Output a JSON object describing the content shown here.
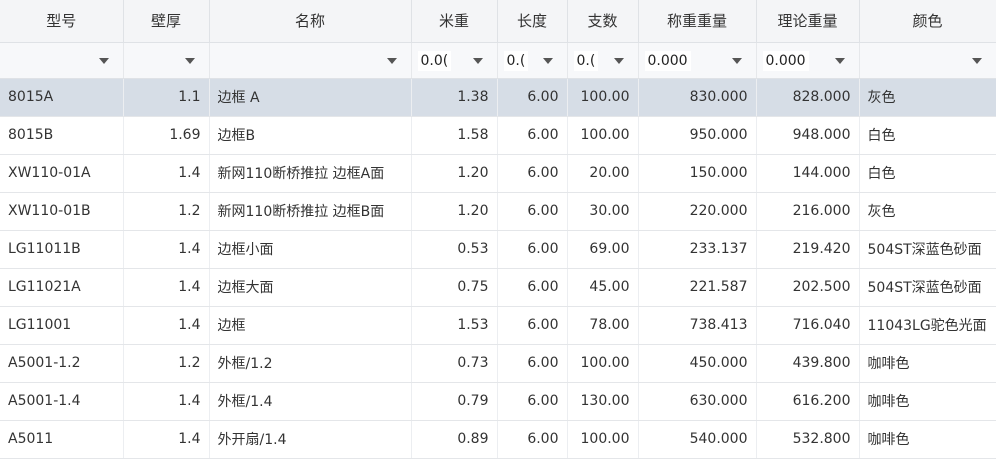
{
  "columns": [
    "型号",
    "壁厚",
    "名称",
    "米重",
    "长度",
    "支数",
    "称重重量",
    "理论重量",
    "颜色"
  ],
  "filters": [
    "",
    "",
    "",
    "0.0(",
    "0.(",
    "0.(",
    "0.000",
    "0.000",
    ""
  ],
  "rows": [
    [
      "8015A",
      "1.1",
      "边框 A",
      "1.38",
      "6.00",
      "100.00",
      "830.000",
      "828.000",
      "灰色"
    ],
    [
      "8015B",
      "1.69",
      "边框B",
      "1.58",
      "6.00",
      "100.00",
      "950.000",
      "948.000",
      "白色"
    ],
    [
      "XW110-01A",
      "1.4",
      "新网110断桥推拉 边框A面",
      "1.20",
      "6.00",
      "20.00",
      "150.000",
      "144.000",
      "白色"
    ],
    [
      "XW110-01B",
      "1.2",
      "新网110断桥推拉 边框B面",
      "1.20",
      "6.00",
      "30.00",
      "220.000",
      "216.000",
      "灰色"
    ],
    [
      "LG11011B",
      "1.4",
      "边框小面",
      "0.53",
      "6.00",
      "69.00",
      "233.137",
      "219.420",
      "504ST深蓝色砂面"
    ],
    [
      "LG11021A",
      "1.4",
      "边框大面",
      "0.75",
      "6.00",
      "45.00",
      "221.587",
      "202.500",
      "504ST深蓝色砂面"
    ],
    [
      "LG11001",
      "1.4",
      "边框",
      "1.53",
      "6.00",
      "78.00",
      "738.413",
      "716.040",
      "11043LG驼色光面"
    ],
    [
      "A5001-1.2",
      "1.2",
      "外框/1.2",
      "0.73",
      "6.00",
      "100.00",
      "450.000",
      "439.800",
      "咖啡色"
    ],
    [
      "A5001-1.4",
      "1.4",
      "外框/1.4",
      "0.79",
      "6.00",
      "130.00",
      "630.000",
      "616.200",
      "咖啡色"
    ],
    [
      "A5011",
      "1.4",
      "外开扇/1.4",
      "0.89",
      "6.00",
      "100.00",
      "540.000",
      "532.800",
      "咖啡色"
    ]
  ],
  "selected_row": 0,
  "colors": {
    "header_bg": "#f4f5f7",
    "selected_bg": "#d6dde6",
    "border": "#e4e6e9"
  }
}
